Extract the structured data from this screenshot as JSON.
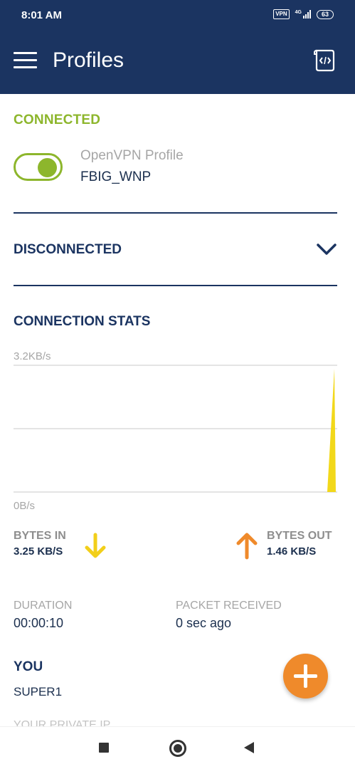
{
  "status_bar": {
    "time": "8:01 AM",
    "vpn_badge": "VPN",
    "network_type": "4G",
    "battery": "63"
  },
  "app_bar": {
    "title": "Profiles",
    "menu_icon": "hamburger-menu-icon",
    "action_icon": "code-document-icon"
  },
  "connected_section": {
    "header": "CONNECTED",
    "toggle_on": true,
    "profile_type": "OpenVPN Profile",
    "profile_name": "FBIG_WNP"
  },
  "disconnected_section": {
    "header": "DISCONNECTED",
    "expand_icon": "chevron-down-icon"
  },
  "stats": {
    "header": "CONNECTION STATS",
    "chart_max_label": "3.2KB/s",
    "chart_min_label": "0B/s",
    "bytes_in_label": "BYTES IN",
    "bytes_in_value": "3.25 KB/S",
    "bytes_out_label": "BYTES OUT",
    "bytes_out_value": "1.46 KB/S",
    "duration_label": "DURATION",
    "duration_value": "00:00:10",
    "packet_label": "PACKET RECEIVED",
    "packet_value": "0 sec ago",
    "you_label": "YOU",
    "you_value": "SUPER1",
    "private_ip_label": "YOUR PRIVATE IP"
  },
  "colors": {
    "primary": "#1b3461",
    "connected_green": "#8db62c",
    "bytes_in_yellow": "#f2cf1a",
    "bytes_out_orange": "#ef8a2b",
    "fab_orange": "#ef8a2b"
  }
}
